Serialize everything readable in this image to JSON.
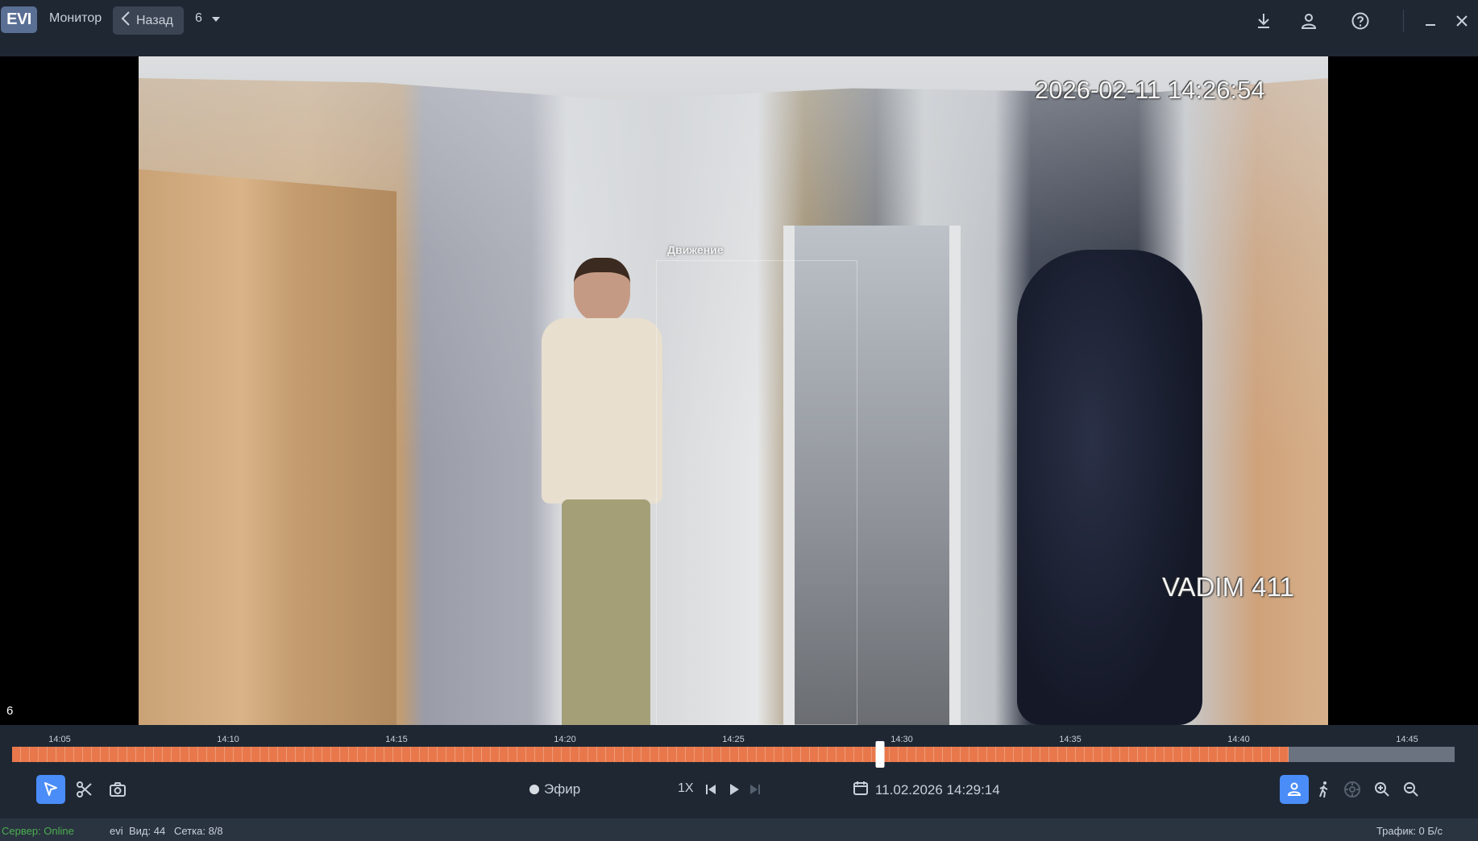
{
  "topbar": {
    "logo": "EVI",
    "monitor_label": "Монитор",
    "back_label": "Назад",
    "view_number": "6"
  },
  "video": {
    "osd_timestamp": "2026-02-11 14:26:54",
    "osd_camera_name": "VADIM 411",
    "motion_label": "Движение",
    "cell_number": "6"
  },
  "timeline": {
    "ticks": [
      "14:05",
      "14:10",
      "14:15",
      "14:20",
      "14:25",
      "14:30",
      "14:35",
      "14:40",
      "14:45"
    ],
    "recorded_color": "#e8784b",
    "empty_color": "#6b7280",
    "recorded_fraction": 0.885,
    "cursor_time": "14:29:14"
  },
  "controls": {
    "live_label": "Эфир",
    "speed_label": "1X",
    "datetime": "11.02.2026 14:29:14"
  },
  "statusbar": {
    "server": "Сервер: Online",
    "user": "evi",
    "view": "Вид: 44",
    "grid": "Сетка: 8/8",
    "traffic": "Трафик: 0 Б/с"
  },
  "colors": {
    "accent": "#4a8df8",
    "background": "#1f2733",
    "online": "#4caf50"
  }
}
